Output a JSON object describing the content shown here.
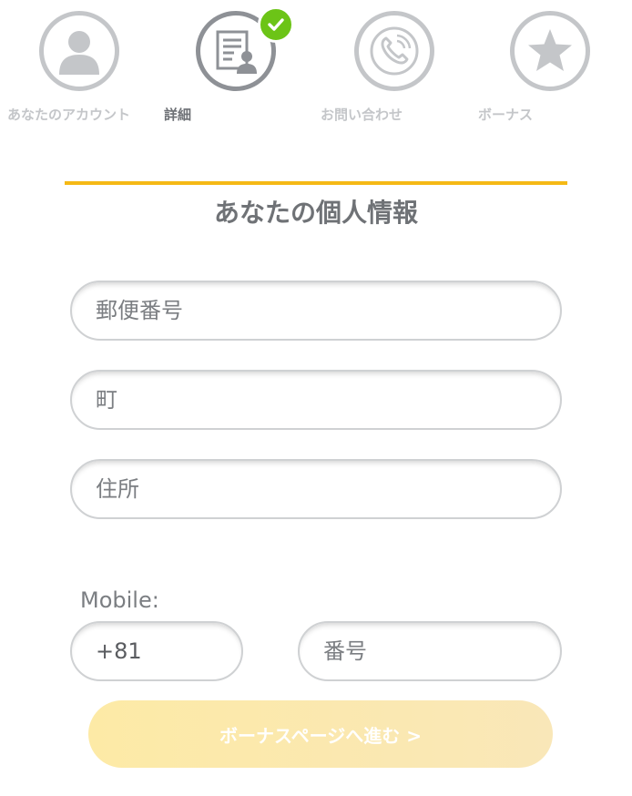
{
  "steps": [
    {
      "label": "あなたのアカウント",
      "icon": "user-icon",
      "state": "inactive"
    },
    {
      "label": "詳細",
      "icon": "document-user-icon",
      "state": "active",
      "completed": true
    },
    {
      "label": "お問い合わせ",
      "icon": "phone-icon",
      "state": "inactive"
    },
    {
      "label": "ボーナス",
      "icon": "star-icon",
      "state": "inactive"
    }
  ],
  "section": {
    "title": "あなたの個人情報"
  },
  "form": {
    "postal_code_placeholder": "郵便番号",
    "town_placeholder": "町",
    "address_placeholder": "住所",
    "mobile_label": "Mobile:",
    "country_code_value": "+81",
    "phone_number_placeholder": "番号"
  },
  "cta": {
    "label": "ボーナスページへ進む >"
  },
  "colors": {
    "accent": "#f5b915",
    "check_green": "#6cc417",
    "inactive_gray": "#c4c6c9",
    "active_gray": "#8e9196",
    "cta_bg": "#fdeaa6"
  }
}
